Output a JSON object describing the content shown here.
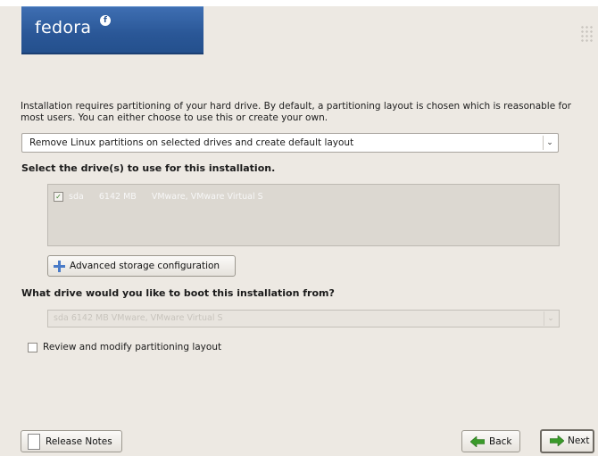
{
  "brand": {
    "logo_text": "fedora",
    "logo_mark": "f"
  },
  "intro_text": "Installation requires partitioning of your hard drive.  By default, a partitioning layout is chosen which is reasonable for most users.  You can either choose to use this or create your own.",
  "layout_select": {
    "value": "Remove Linux partitions on selected drives and create default layout"
  },
  "drives_label": "Select the drive(s) to use for this installation.",
  "drives": [
    {
      "checked": true,
      "name": "sda",
      "size": "6142 MB",
      "model": "VMware, VMware Virtual S"
    }
  ],
  "advanced_button": {
    "label": "Advanced storage configuration"
  },
  "boot_label": "What drive would you like to boot this installation from?",
  "boot_select": {
    "value": "sda    6142 MB VMware, VMware Virtual S"
  },
  "review_checkbox": {
    "label": "Review and modify partitioning layout",
    "checked": false
  },
  "footer": {
    "release_notes": "Release Notes",
    "back": "Back",
    "next": "Next"
  },
  "colors": {
    "banner": "#2a5797",
    "background": "#ede9e3",
    "accent_green": "#3a9a2a"
  }
}
